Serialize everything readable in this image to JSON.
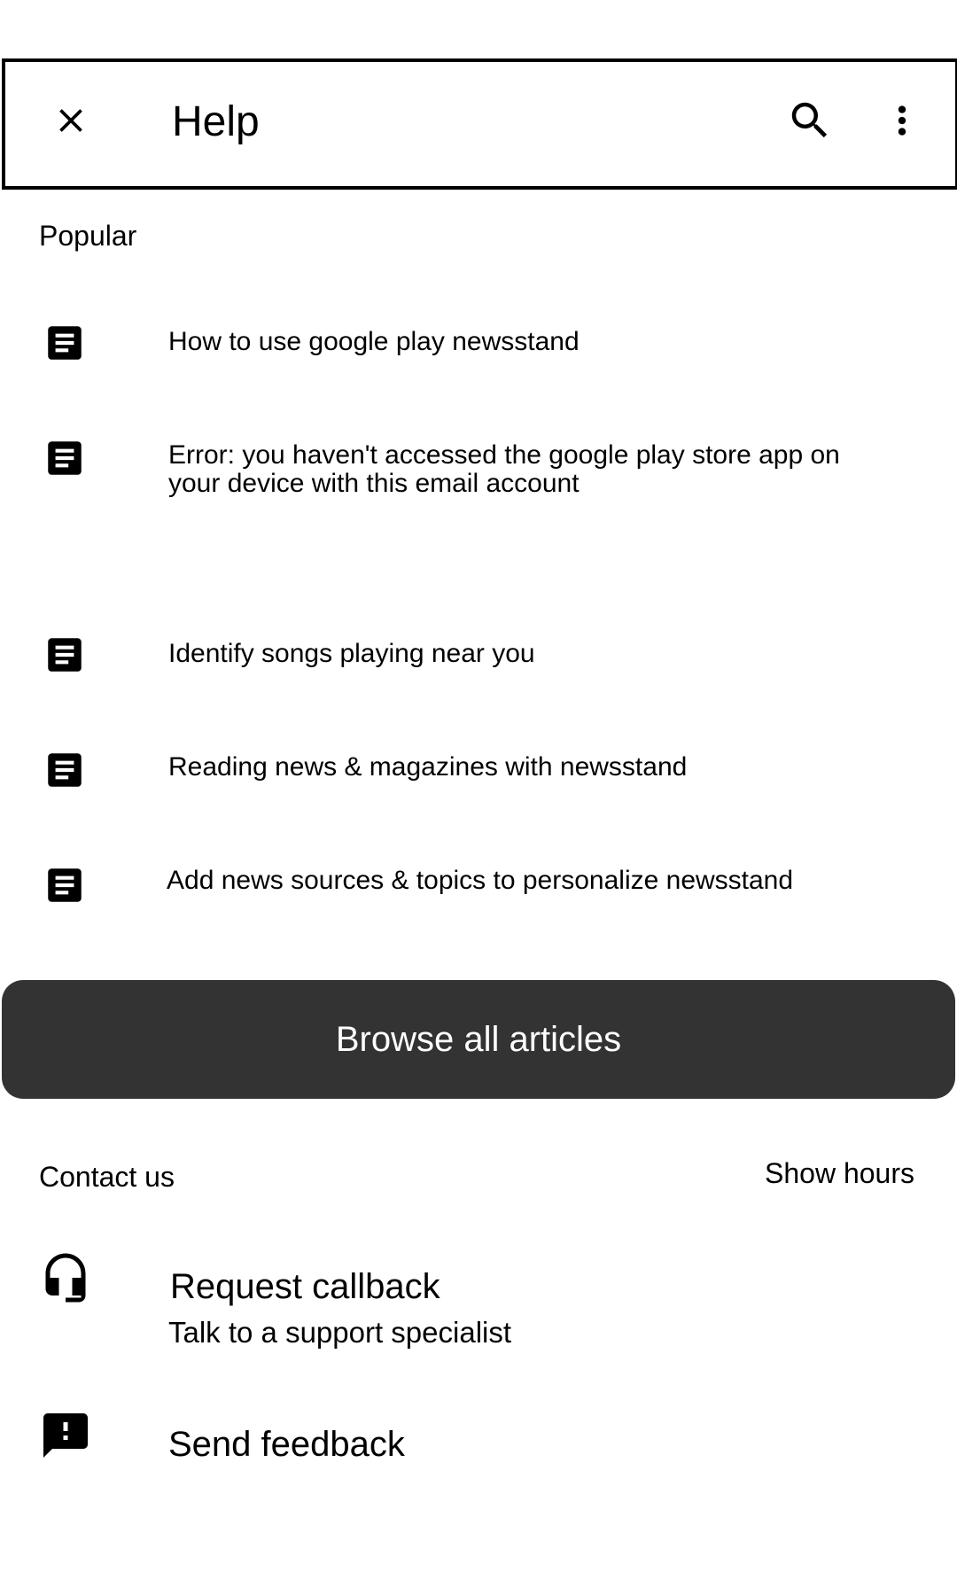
{
  "toolbar": {
    "title": "Help",
    "close_icon": "close-icon",
    "search_icon": "search-icon",
    "more_icon": "more-vert-icon"
  },
  "popular": {
    "title": "Popular",
    "articles": [
      {
        "label": "How to use google play newsstand",
        "icon": "article-icon"
      },
      {
        "label": "Error: you haven't accessed the google play store app on your device with this email account",
        "icon": "article-icon"
      },
      {
        "label": "Identify songs playing near you",
        "icon": "article-icon"
      },
      {
        "label": "Reading news & magazines with newsstand",
        "icon": "article-icon"
      },
      {
        "label": "Add news sources & topics to personalize newsstand",
        "icon": "article-icon"
      }
    ]
  },
  "browse": {
    "label": "Browse all articles"
  },
  "contact": {
    "title": "Contact us",
    "show_hours": "Show hours",
    "callback": {
      "title": "Request callback",
      "subtitle": "Talk to a support specialist",
      "icon": "headset-icon"
    },
    "feedback": {
      "title": "Send feedback",
      "icon": "feedback-icon"
    }
  },
  "colors": {
    "button_bg": "#333333",
    "button_text": "#ffffff",
    "text": "#000000",
    "background": "#ffffff"
  }
}
